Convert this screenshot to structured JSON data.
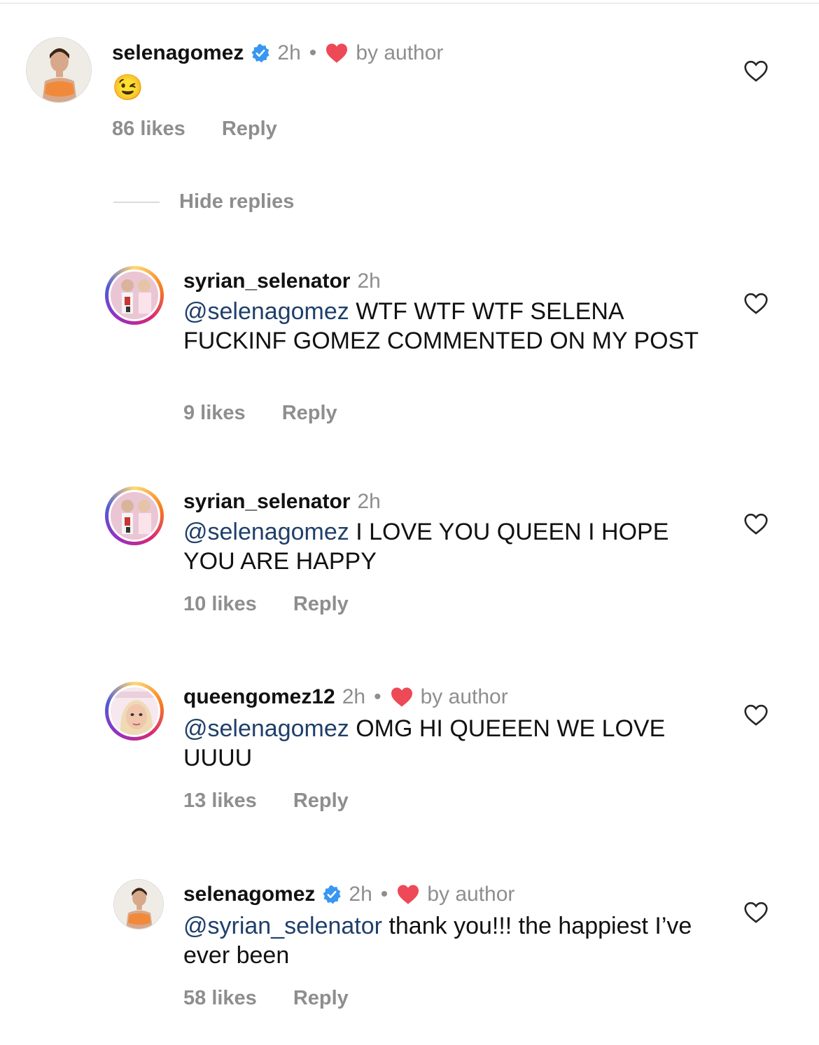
{
  "colors": {
    "mention": "#1f3f6b",
    "muted": "#8e8e8e",
    "heart": "#ed4956",
    "verified": "#3897f0"
  },
  "main_comment": {
    "username": "selenagomez",
    "verified": true,
    "time": "2h",
    "author_liked": true,
    "by_author": "by author",
    "text": "😉",
    "likes": "86 likes",
    "reply": "Reply"
  },
  "hide_replies": "Hide replies",
  "replies": [
    {
      "username": "syrian_selenator",
      "time": "2h",
      "mention": "@selenagomez",
      "text": " WTF WTF WTF SELENA FUCKINF GOMEZ COMMENTED ON MY POST",
      "likes": "9 likes",
      "reply": "Reply"
    },
    {
      "username": "syrian_selenator",
      "time": "2h",
      "mention": "@selenagomez",
      "text": " I LOVE YOU QUEEN I HOPE YOU ARE HAPPY",
      "likes": "10 likes",
      "reply": "Reply"
    },
    {
      "username": "queengomez12",
      "time": "2h",
      "author_liked": true,
      "by_author": "by author",
      "mention": "@selenagomez",
      "text": " OMG HI QUEEEN WE LOVE UUUU",
      "likes": "13 likes",
      "reply": "Reply"
    },
    {
      "username": "selenagomez",
      "verified": true,
      "time": "2h",
      "author_liked": true,
      "by_author": "by author",
      "mention": "@syrian_selenator",
      "text": " thank you!!! the happiest I’ve ever been",
      "likes": "58 likes",
      "reply": "Reply"
    }
  ]
}
